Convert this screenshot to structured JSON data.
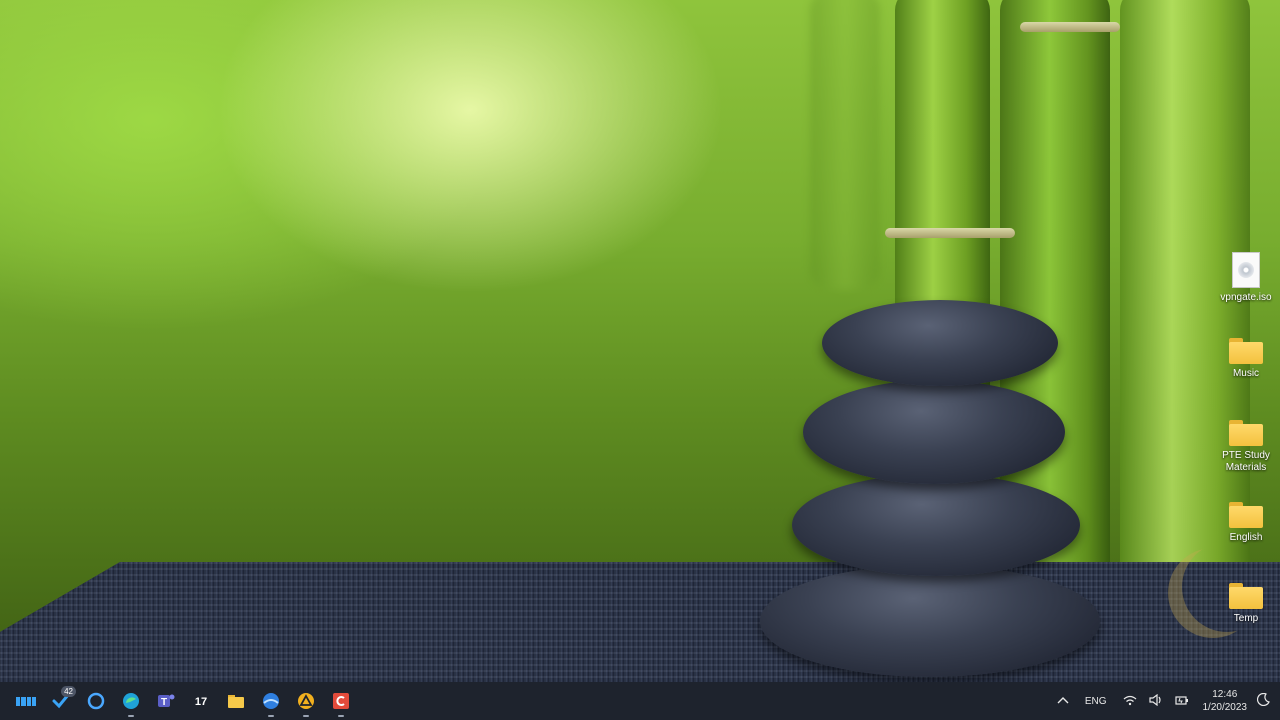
{
  "desktop": {
    "icons": [
      {
        "label": "vpngate.iso",
        "type": "iso-file-icon"
      },
      {
        "label": "Music",
        "type": "folder-icon"
      },
      {
        "label": "PTE Study Materials",
        "type": "folder-icon"
      },
      {
        "label": "English",
        "type": "folder-icon"
      },
      {
        "label": "Temp",
        "type": "folder-icon"
      }
    ]
  },
  "taskbar": {
    "apps": [
      {
        "name": "start-button",
        "icon": "windows-logo-icon"
      },
      {
        "name": "todo-app",
        "icon": "checkmark-icon",
        "badge": "42"
      },
      {
        "name": "cortana-app",
        "icon": "circle-ring-icon"
      },
      {
        "name": "edge-browser",
        "icon": "edge-icon"
      },
      {
        "name": "teams-app",
        "icon": "teams-icon"
      },
      {
        "name": "tradingview-app",
        "icon": "tv-logo-icon"
      },
      {
        "name": "file-explorer",
        "icon": "folder-icon"
      },
      {
        "name": "browser-app",
        "icon": "globe-icon"
      },
      {
        "name": "vpn-app",
        "icon": "triangle-icon"
      },
      {
        "name": "red-app",
        "icon": "c-logo-icon"
      }
    ],
    "tray": {
      "language": "ENG",
      "time": "12:46",
      "date": "1/20/2023"
    }
  },
  "colors": {
    "taskbar_bg": "#1e232d",
    "accent": "#3aa3f5"
  }
}
